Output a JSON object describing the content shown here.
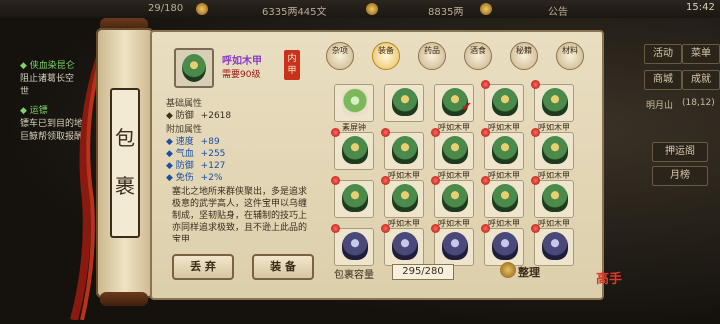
{
  "topbar": {
    "level_text": "29/180",
    "money_text": "6335两445文",
    "gem_text": "8835两",
    "notice_label": "公告",
    "clock": "15:42"
  },
  "quest": {
    "q1_title": "◆ 侠血染昆仑",
    "q1_text": "阻止诸葛长空\n世",
    "q2_title": "◆ 运镖",
    "q2_text": "镖车已到目的地,\n巨鲸帮领取报酬"
  },
  "right_menu": {
    "items": [
      "活动",
      "菜单",
      "商城",
      "成就",
      "明月山"
    ],
    "coords": "(18,12)",
    "escort": "押运阁",
    "list": "月榜"
  },
  "bag": {
    "title_chars": [
      "包",
      "裹"
    ]
  },
  "detail": {
    "name": "呼如木甲",
    "requirement": "需要90级",
    "stamp": "内甲",
    "base_header": "基础属性",
    "base_stats": [
      {
        "label": "◆ 防御",
        "value": "+2618"
      }
    ],
    "extra_header": "附加属性",
    "extra_stats": [
      {
        "label": "◆ 速度",
        "value": "+89"
      },
      {
        "label": "◆ 气血",
        "value": "+255"
      },
      {
        "label": "◆ 防御",
        "value": "+127"
      },
      {
        "label": "◆ 免伤",
        "value": "+2%"
      }
    ],
    "description": "塞北之地所来群侠聚出，多是追求极意的武学高人，这件宝甲以乌缠制成，坚韧贴身，在辅制的技巧上亦同样追求极致，且不逊上此品的宝甲",
    "discard_label": "丢 弃",
    "equip_label": "装 备"
  },
  "tabs": [
    {
      "label": "杂项",
      "active": false
    },
    {
      "label": "装备",
      "active": true
    },
    {
      "label": "药品",
      "active": false
    },
    {
      "label": "酒食",
      "active": false
    },
    {
      "label": "秘籍",
      "active": false
    },
    {
      "label": "材料",
      "active": false
    }
  ],
  "grid": {
    "items": [
      {
        "label": "素屏钟",
        "kind": "bell",
        "dot": false,
        "check": false
      },
      {
        "label": "",
        "kind": "green",
        "dot": false,
        "check": false
      },
      {
        "label": "呼如木甲",
        "kind": "green",
        "dot": false,
        "check": true
      },
      {
        "label": "呼如木甲",
        "kind": "green",
        "dot": true,
        "check": false
      },
      {
        "label": "呼如木甲",
        "kind": "green",
        "dot": true,
        "check": false
      },
      {
        "label": "",
        "kind": "green",
        "dot": true,
        "check": false
      },
      {
        "label": "呼如木甲",
        "kind": "green",
        "dot": true,
        "check": false
      },
      {
        "label": "呼如木甲",
        "kind": "green",
        "dot": true,
        "check": false
      },
      {
        "label": "呼如木甲",
        "kind": "green",
        "dot": true,
        "check": false
      },
      {
        "label": "呼如木甲",
        "kind": "green",
        "dot": true,
        "check": false
      },
      {
        "label": "",
        "kind": "green",
        "dot": true,
        "check": false
      },
      {
        "label": "呼如木甲",
        "kind": "green",
        "dot": true,
        "check": false
      },
      {
        "label": "呼如木甲",
        "kind": "green",
        "dot": true,
        "check": false
      },
      {
        "label": "呼如木甲",
        "kind": "green",
        "dot": true,
        "check": false
      },
      {
        "label": "呼如木甲",
        "kind": "green",
        "dot": true,
        "check": false
      },
      {
        "label": "",
        "kind": "blue",
        "dot": true,
        "check": false
      },
      {
        "label": "",
        "kind": "blue",
        "dot": true,
        "check": false
      },
      {
        "label": "",
        "kind": "blue",
        "dot": true,
        "check": false
      },
      {
        "label": "",
        "kind": "blue",
        "dot": true,
        "check": false
      },
      {
        "label": "",
        "kind": "blue",
        "dot": true,
        "check": false
      }
    ]
  },
  "footer": {
    "capacity_label": "包裹容量",
    "capacity_value": "295/280",
    "sort_label": "整理"
  },
  "logo_text": "高手"
}
